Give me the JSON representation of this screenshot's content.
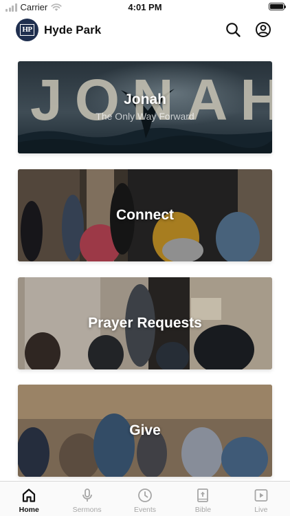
{
  "status_bar": {
    "carrier": "Carrier",
    "time": "4:01 PM"
  },
  "header": {
    "avatar_text": "HP",
    "title": "Hyde Park",
    "search_icon": "search-icon",
    "profile_icon": "person-circle-icon"
  },
  "cards": [
    {
      "id": "jonah",
      "title": "Jonah",
      "subtitle": "The Only Way Forward",
      "backdrop_text": "JONAH"
    },
    {
      "id": "connect",
      "title": "Connect"
    },
    {
      "id": "prayer",
      "title": "Prayer Requests"
    },
    {
      "id": "give",
      "title": "Give"
    }
  ],
  "tab_bar": {
    "tabs": [
      {
        "label": "Home",
        "icon": "home-icon",
        "active": true
      },
      {
        "label": "Sermons",
        "icon": "microphone-icon",
        "active": false
      },
      {
        "label": "Events",
        "icon": "clock-icon",
        "active": false
      },
      {
        "label": "Bible",
        "icon": "bible-icon",
        "active": false
      },
      {
        "label": "Live",
        "icon": "play-icon",
        "active": false
      }
    ]
  },
  "colors": {
    "avatar_bg": "#1f2f4f",
    "tab_active": "#111111",
    "tab_inactive": "#a6a6a6"
  }
}
